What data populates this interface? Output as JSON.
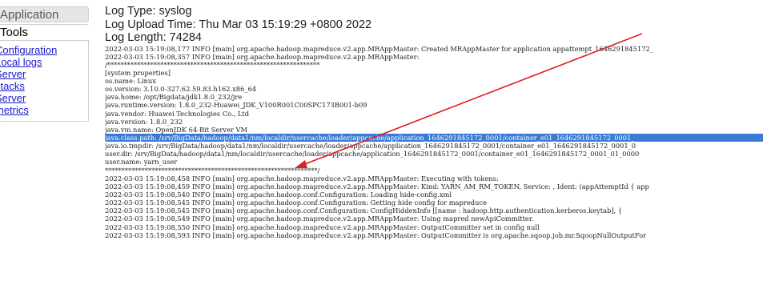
{
  "sidebar": {
    "application_label": "Application",
    "tools_label": "Tools",
    "tools_links": [
      "Configuration",
      "Local logs",
      "Server",
      "stacks",
      "Server",
      "metrics"
    ]
  },
  "header": {
    "log_type": "Log Type: syslog",
    "upload_time": "Log Upload Time: Thu Mar 03 15:19:29 +0800 2022",
    "log_length": "Log Length: 74284"
  },
  "log_lines": [
    "2022-03-03 15:19:08,177 INFO [main] org.apache.hadoop.mapreduce.v2.app.MRAppMaster: Created MRAppMaster for application appattempt_1646291845172_",
    "2022-03-03 15:19:08,357 INFO [main] org.apache.hadoop.mapreduce.v2.app.MRAppMaster:",
    "/****************************************************************",
    "[system properties]",
    "os.name: Linux",
    "os.version: 3.10.0-327.62.59.83.h162.x86_64",
    "java.home: /opt/Bigdata/jdk1.8.0_232/jre",
    "java.runtime.version: 1.8.0_232-Huawei_JDK_V100R001C00SPC173B001-b09",
    "java.vendor: Huawei Technologies Co., Ltd",
    "java.version: 1.8.0_232",
    "java.vm.name: OpenJDK 64-Bit Server VM",
    "java.class.path: /srv/BigData/hadoop/data1/nm/localdir/usercache/loader/appcache/application_1646291845172_0001/container_e01_1646291845172_0001_",
    "java.io.tmpdir: /srv/BigData/hadoop/data1/nm/localdir/usercache/loader/appcache/application_1646291845172_0001/container_e01_1646291845172_0001_0",
    "user.dir: /srv/BigData/hadoop/data1/nm/localdir/usercache/loader/appcache/application_1646291845172_0001/container_e01_1646291845172_0001_01_0000",
    "user.name: yarn_user",
    "****************************************************************/",
    "2022-03-03 15:19:08,458 INFO [main] org.apache.hadoop.mapreduce.v2.app.MRAppMaster: Executing with tokens:",
    "2022-03-03 15:19:08,459 INFO [main] org.apache.hadoop.mapreduce.v2.app.MRAppMaster: Kind: YARN_AM_RM_TOKEN, Service: , Ident: (appAttemptId { app",
    "2022-03-03 15:19:08,540 INFO [main] org.apache.hadoop.conf.Configuration: Loading hide-config.xml",
    "2022-03-03 15:19:08,545 INFO [main] org.apache.hadoop.conf.Configuration: Getting hide config for mapreduce",
    "2022-03-03 15:19:08,545 INFO [main] org.apache.hadoop.conf.Configuration: ConfigHiddenInfo [[name : hadoop.http.authentication.kerberos.keytab], {",
    "2022-03-03 15:19:08,549 INFO [main] org.apache.hadoop.mapreduce.v2.app.MRAppMaster: Using mapred newApiCommitter.",
    "2022-03-03 15:19:08,550 INFO [main] org.apache.hadoop.mapreduce.v2.app.MRAppMaster: OutputCommitter set in config null",
    "2022-03-03 15:19:08,593 INFO [main] org.apache.hadoop.mapreduce.v2.app.MRAppMaster: OutputCommitter is org.apache.sqoop.job.mr.SqoopNullOutputFor"
  ],
  "highlighted_line_index": 11,
  "colors": {
    "link": "#1a1ac8",
    "highlight": "#3a7bd5",
    "annotation_arrow": "#e02020"
  }
}
